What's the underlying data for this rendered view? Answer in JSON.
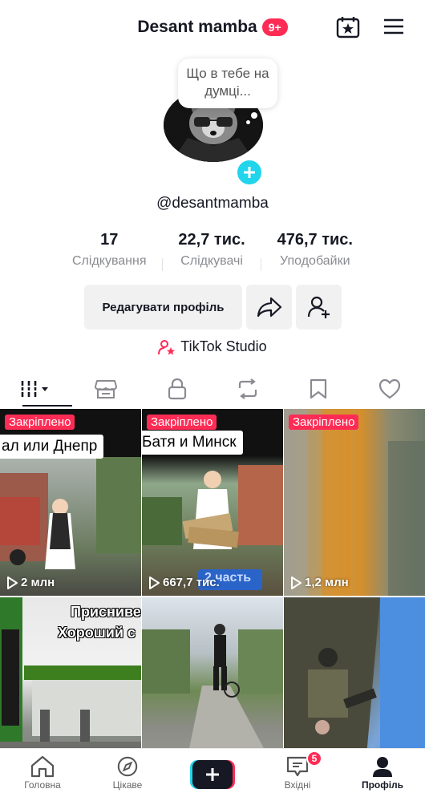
{
  "header": {
    "title": "Desant mamba",
    "badge": "9+"
  },
  "profile": {
    "bubble_text": "Що в тебе на думці...",
    "username": "@desantmamba"
  },
  "stats": [
    {
      "value": "17",
      "label": "Слідкування"
    },
    {
      "value": "22,7 тис.",
      "label": "Слідкувачі"
    },
    {
      "value": "476,7 тис.",
      "label": "Уподобайки"
    }
  ],
  "actions": {
    "edit_label": "Редагувати профіль",
    "studio_label": "TikTok Studio"
  },
  "videos": [
    {
      "pinned": "Закріплено",
      "caption": "ал или Днепр",
      "views": "2 млн"
    },
    {
      "pinned": "Закріплено",
      "caption": "Батя и Минск",
      "views": "667,7 тис.",
      "overlay": "2 часть"
    },
    {
      "pinned": "Закріплено",
      "caption": "",
      "views": "1,2 млн"
    },
    {
      "caption1": "Присниве",
      "caption2": "Хороший с"
    },
    {},
    {}
  ],
  "nav": [
    {
      "label": "Головна",
      "icon": "home-icon"
    },
    {
      "label": "Цікаве",
      "icon": "compass-icon"
    },
    {
      "label": "",
      "icon": "create-icon"
    },
    {
      "label": "Вхідні",
      "icon": "inbox-icon",
      "badge": "5"
    },
    {
      "label": "Профіль",
      "icon": "profile-icon"
    }
  ],
  "colors": {
    "accent": "#fe2c55",
    "cyan": "#20d5ec"
  }
}
